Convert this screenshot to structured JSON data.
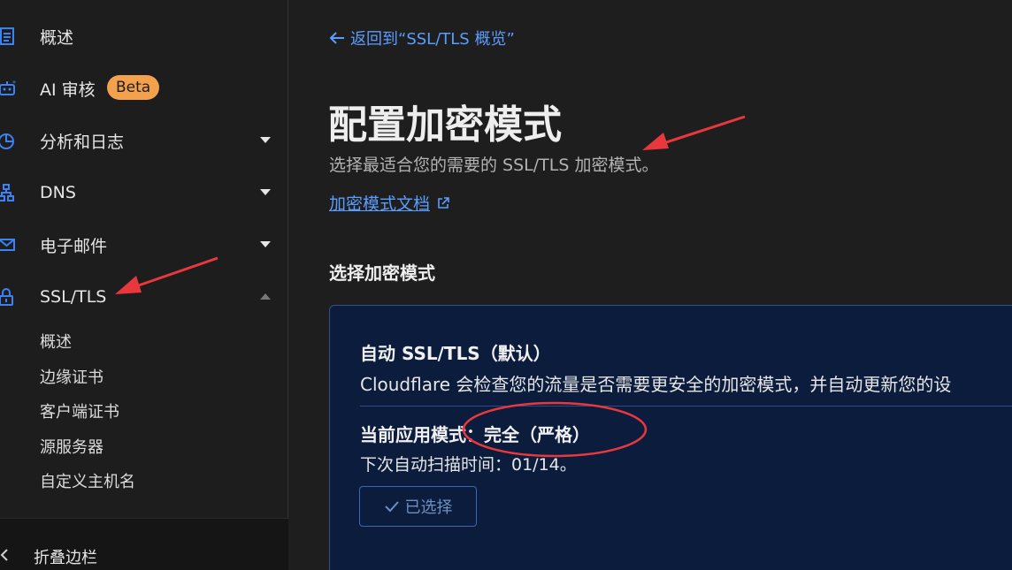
{
  "sidebar": {
    "items": [
      {
        "label": "概述",
        "icon": "document-icon"
      },
      {
        "label": "AI 审核",
        "icon": "robot-icon",
        "badge": "Beta"
      },
      {
        "label": "分析和日志",
        "icon": "pie-chart-icon",
        "caret": "down"
      },
      {
        "label": "DNS",
        "icon": "network-icon",
        "caret": "down"
      },
      {
        "label": "电子邮件",
        "icon": "mail-icon",
        "caret": "down"
      },
      {
        "label": "SSL/TLS",
        "icon": "lock-icon",
        "caret": "up"
      }
    ],
    "ssl_sub_items": [
      "概述",
      "边缘证书",
      "客户端证书",
      "源服务器",
      "自定义主机名"
    ],
    "collapse_label": "折叠边栏"
  },
  "main": {
    "back_link": "返回到“SSL/TLS 概览”",
    "title": "配置加密模式",
    "subtitle": "选择最适合您的需要的 SSL/TLS 加密模式。",
    "doc_link": "加密模式文档",
    "section_title": "选择加密模式",
    "card": {
      "title": "自动 SSL/TLS（默认）",
      "description": "Cloudflare 会检查您的流量是否需要更安全的加密模式，并自动更新您的设",
      "current_mode": "当前应用模式：完全（严格）",
      "next_scan": "下次自动扫描时间：01/14。",
      "selected_label": "已选择"
    }
  },
  "colors": {
    "accent": "#5b9dff",
    "badge": "#f4a14e",
    "card_bg": "#0b1c3d",
    "annotation": "#e8383d"
  }
}
